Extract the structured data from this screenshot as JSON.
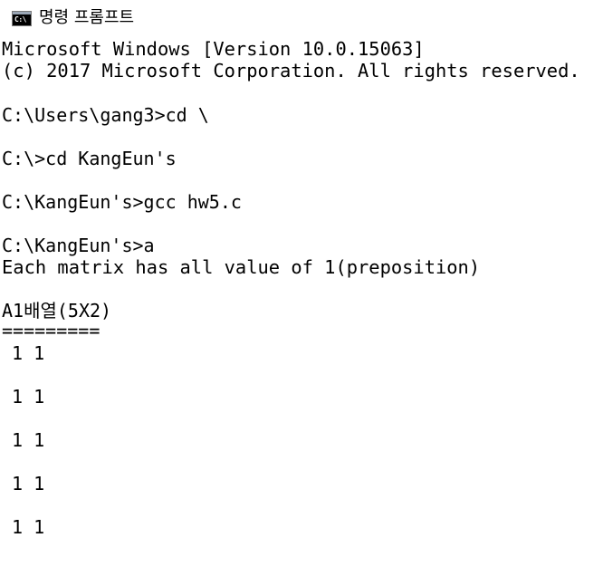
{
  "window": {
    "title": "명령 프롬프트",
    "icon_label": "C:\\"
  },
  "console": {
    "lines": [
      "Microsoft Windows [Version 10.0.15063]",
      "(c) 2017 Microsoft Corporation. All rights reserved.",
      "",
      "C:\\Users\\gang3>cd \\",
      "",
      "C:\\>cd KangEun's",
      "",
      "C:\\KangEun's>gcc hw5.c",
      "",
      "C:\\KangEun's>a",
      "Each matrix has all value of 1(preposition)",
      "",
      "A1배열(5X2)",
      "========="
    ],
    "matrix_rows": [
      "1 1",
      "1 1",
      "1 1",
      "1 1",
      "1 1"
    ]
  }
}
